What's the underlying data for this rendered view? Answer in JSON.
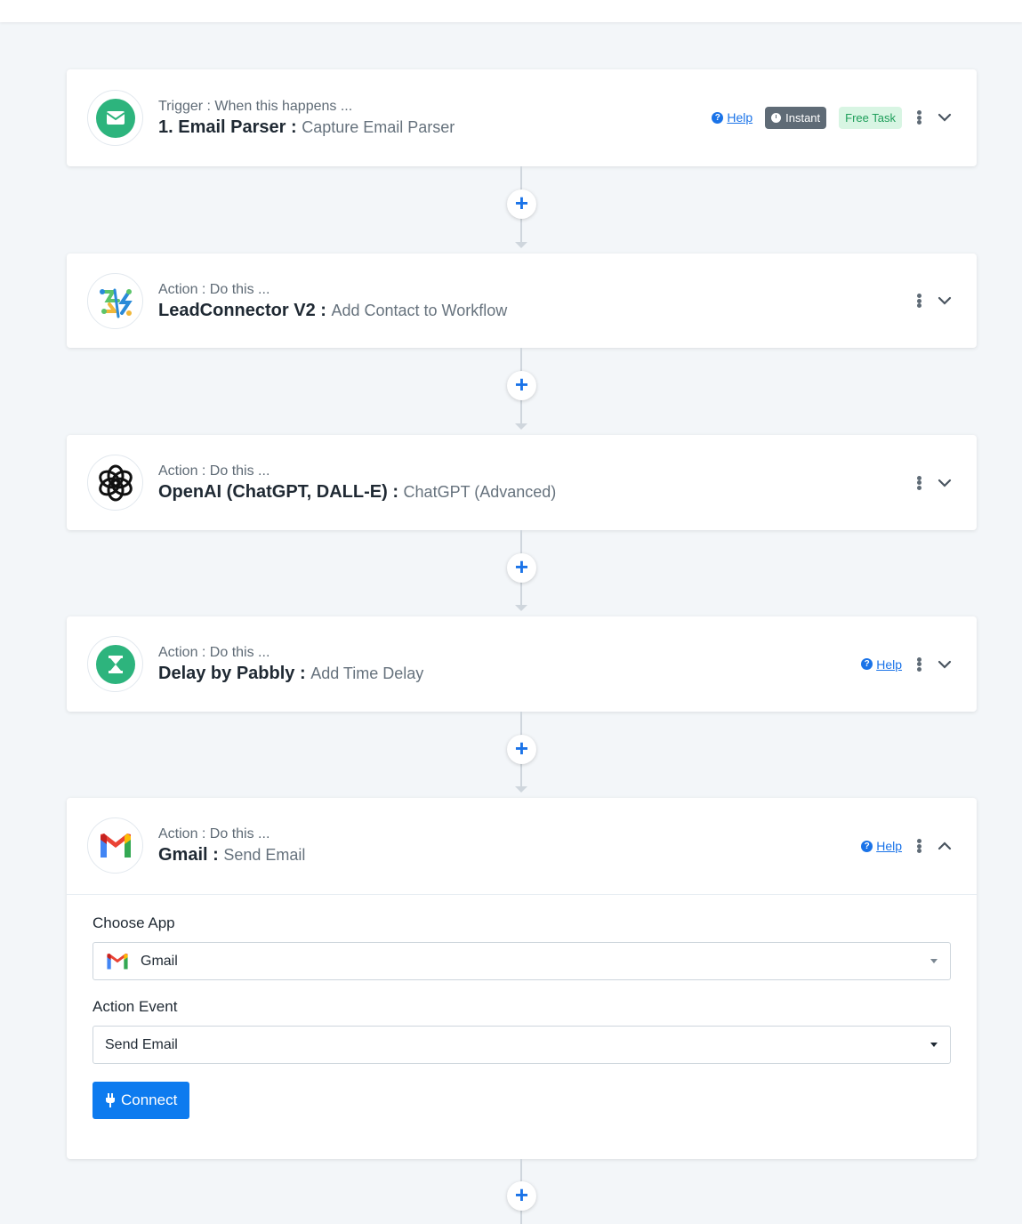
{
  "steps": [
    {
      "label": "Trigger : When this happens ...",
      "app": "1. Email Parser :",
      "event": "Capture Email Parser",
      "icon": "email-parser-icon",
      "help": "Help",
      "badge_instant": "Instant",
      "badge_free": "Free Task"
    },
    {
      "label": "Action : Do this ...",
      "app": "LeadConnector V2 :",
      "event": "Add Contact to Workflow",
      "icon": "leadconnector-icon"
    },
    {
      "label": "Action : Do this ...",
      "app": "OpenAI (ChatGPT, DALL-E) :",
      "event": "ChatGPT (Advanced)",
      "icon": "openai-icon"
    },
    {
      "label": "Action : Do this ...",
      "app": "Delay by Pabbly :",
      "event": "Add Time Delay",
      "icon": "hourglass-icon",
      "help": "Help"
    },
    {
      "label": "Action : Do this ...",
      "app": "Gmail :",
      "event": "Send Email",
      "icon": "gmail-icon",
      "help": "Help"
    }
  ],
  "form": {
    "choose_app_label": "Choose App",
    "choose_app_value": "Gmail",
    "action_event_label": "Action Event",
    "action_event_value": "Send Email",
    "connect_label": "Connect"
  },
  "colors": {
    "accent": "#1a73e8",
    "connect_button": "#0d7bef",
    "brand_green": "#2db47d"
  }
}
